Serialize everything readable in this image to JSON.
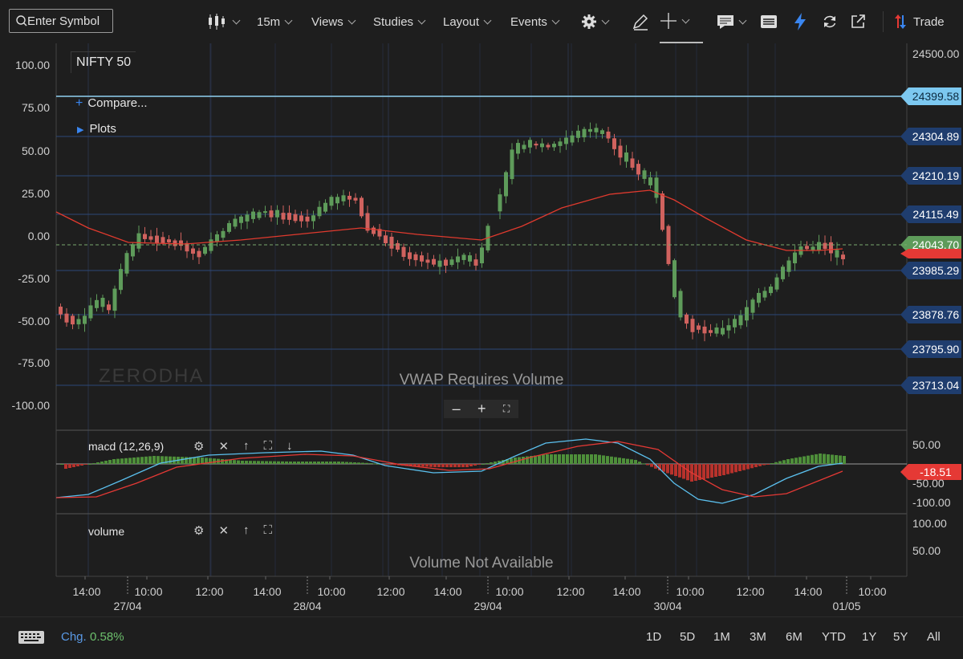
{
  "toolbar": {
    "search_placeholder": "Enter Symbol",
    "interval": "15m",
    "views": "Views",
    "studies": "Studies",
    "layout": "Layout",
    "events": "Events",
    "trade": "Trade"
  },
  "chart": {
    "symbol": "NIFTY 50",
    "compare": "Compare...",
    "plots": "Plots",
    "watermark": "ZERODHA",
    "vwap_msg": "VWAP Requires Volume",
    "volume_msg": "Volume Not Available",
    "left_axis": [
      "100.00",
      "75.00",
      "50.00",
      "25.00",
      "0.00",
      "-25.00",
      "-50.00",
      "-75.00",
      "-100.00"
    ],
    "right_axis": [
      "24500.00"
    ],
    "price_levels": [
      "24399.58",
      "24304.89",
      "24210.19",
      "24115.49",
      "24043.70",
      "23985.29",
      "23878.76",
      "23795.90",
      "23713.04"
    ],
    "current_price": "24043.70",
    "macd_label": "macd (12,26,9)",
    "macd_axis": [
      "50.00",
      "-50.00",
      "-100.00"
    ],
    "macd_value": "-18.51",
    "volume_label": "volume",
    "volume_axis": [
      "100.00",
      "50.00"
    ],
    "time_labels": [
      "14:00",
      "10:00",
      "12:00",
      "14:00",
      "10:00",
      "12:00",
      "14:00",
      "10:00",
      "12:00",
      "14:00",
      "10:00",
      "12:00",
      "14:00",
      "10:00"
    ],
    "date_labels": [
      "27/04",
      "28/04",
      "29/04",
      "30/04",
      "01/05"
    ],
    "colors": {
      "up": "#5e9b5a",
      "down": "#d0625e",
      "ma": "#e03a2e",
      "level": "#1f3d6e",
      "macd_line": "#5bc0ee",
      "signal": "#e53935"
    }
  },
  "bottom": {
    "chg_label": "Chg.",
    "chg_value": "0.58%",
    "ranges": [
      "1D",
      "5D",
      "1M",
      "3M",
      "6M",
      "YTD",
      "1Y",
      "5Y",
      "All"
    ]
  }
}
